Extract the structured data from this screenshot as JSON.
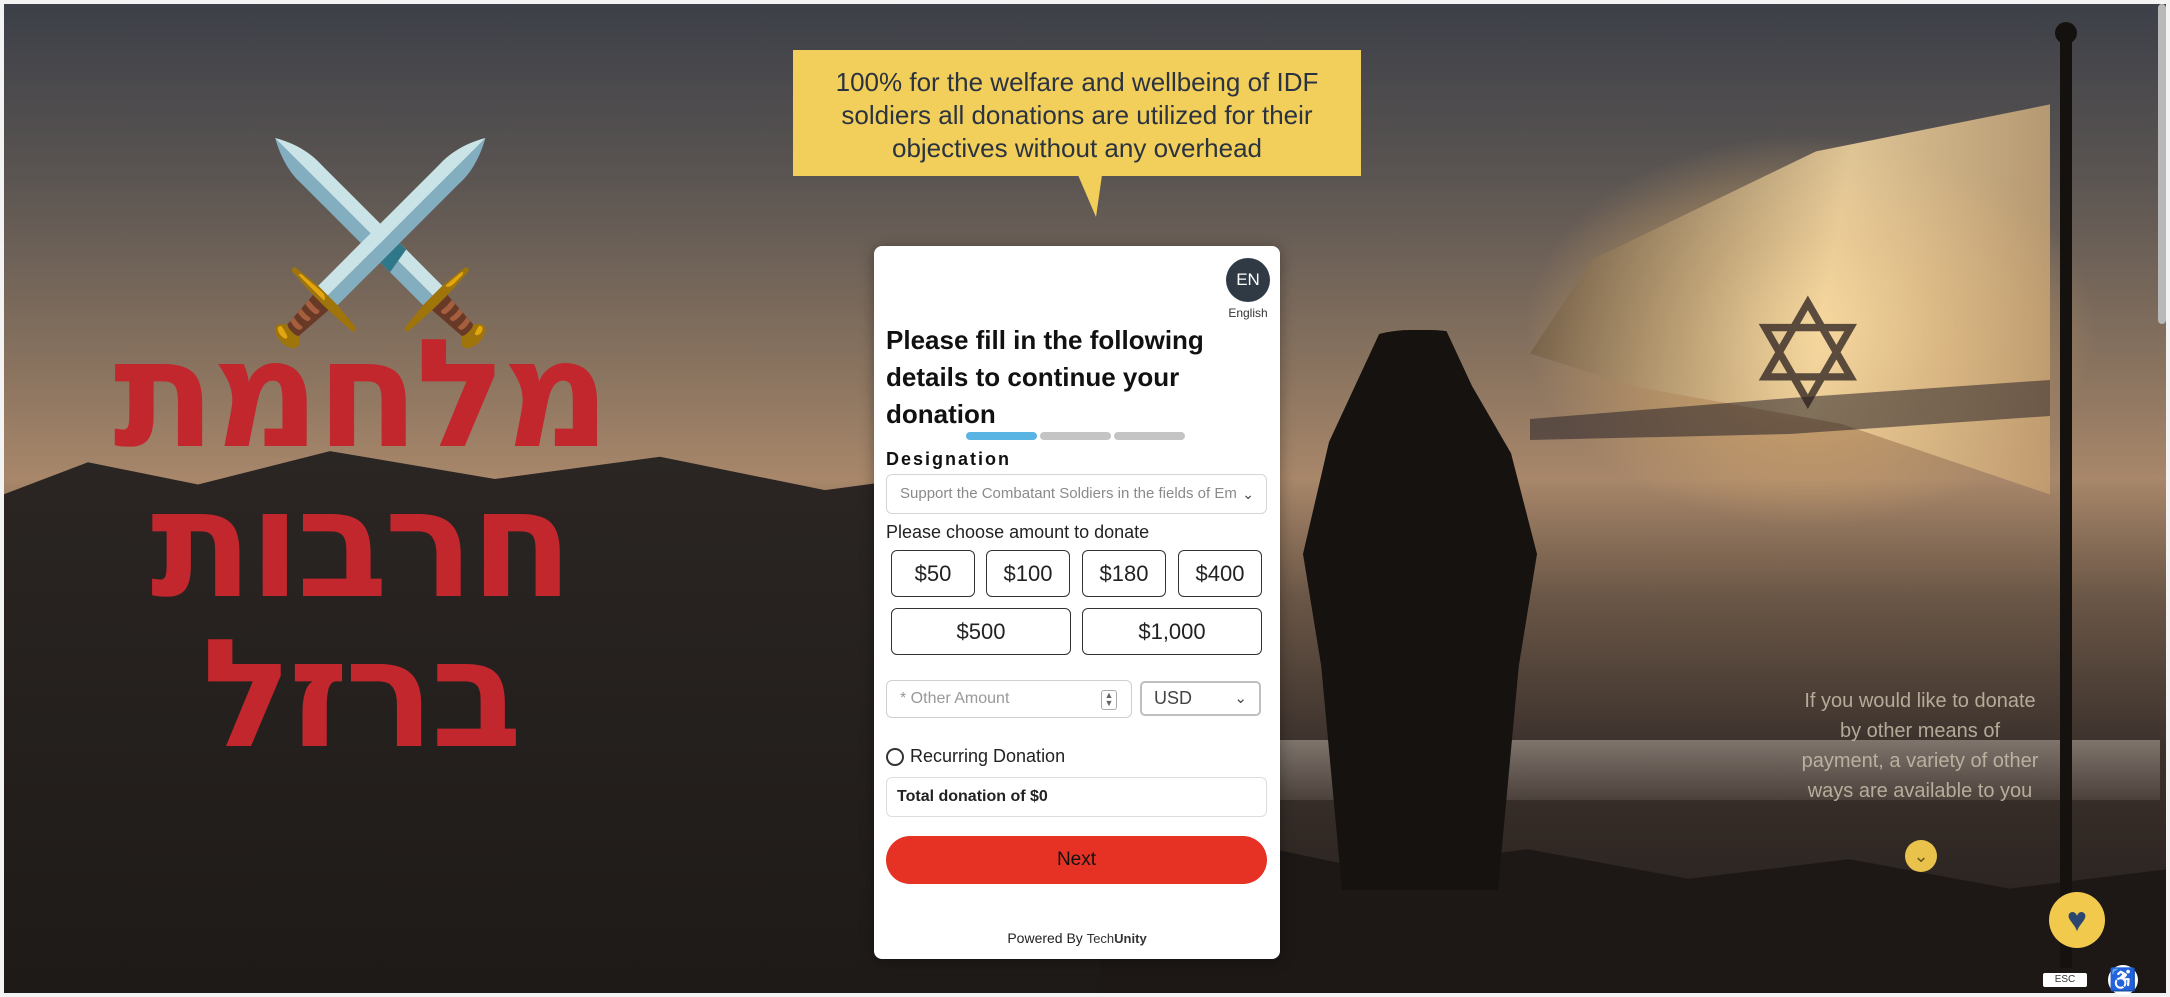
{
  "background": {
    "hebrew_title_lines": [
      "מלחמת",
      "חרבות",
      "ברזל"
    ],
    "swords_emoji": "⚔️",
    "title_color": "#c1272d"
  },
  "banner": {
    "text": "100% for the welfare and wellbeing of IDF soldiers all donations are utilized for their objectives without any overhead",
    "color": "#f2cf5a"
  },
  "form": {
    "language_code": "EN",
    "language_name": "English",
    "title": "Please fill in the following details to continue your donation",
    "steps_total": 3,
    "step_active": 1,
    "designation_label": "Designation",
    "designation_value": "Support the Combatant Soldiers in the fields of Em",
    "amount_prompt": "Please choose amount to donate",
    "amounts": [
      "$50",
      "$100",
      "$180",
      "$400",
      "$500",
      "$1,000"
    ],
    "other_amount_placeholder": "* Other Amount",
    "currency": "USD",
    "recurring_label": "Recurring Donation",
    "total_label": "Total donation of $0",
    "next_label": "Next",
    "powered_by": "Powered By",
    "brand_prefix": "Tech",
    "brand_suffix": "Unity",
    "accent_color": "#e53224",
    "step_color": "#5ab4e3"
  },
  "side": {
    "other_means_text": "If you would like to donate by other means of payment, a variety of other ways are available to you",
    "esc_label": "ESC"
  }
}
